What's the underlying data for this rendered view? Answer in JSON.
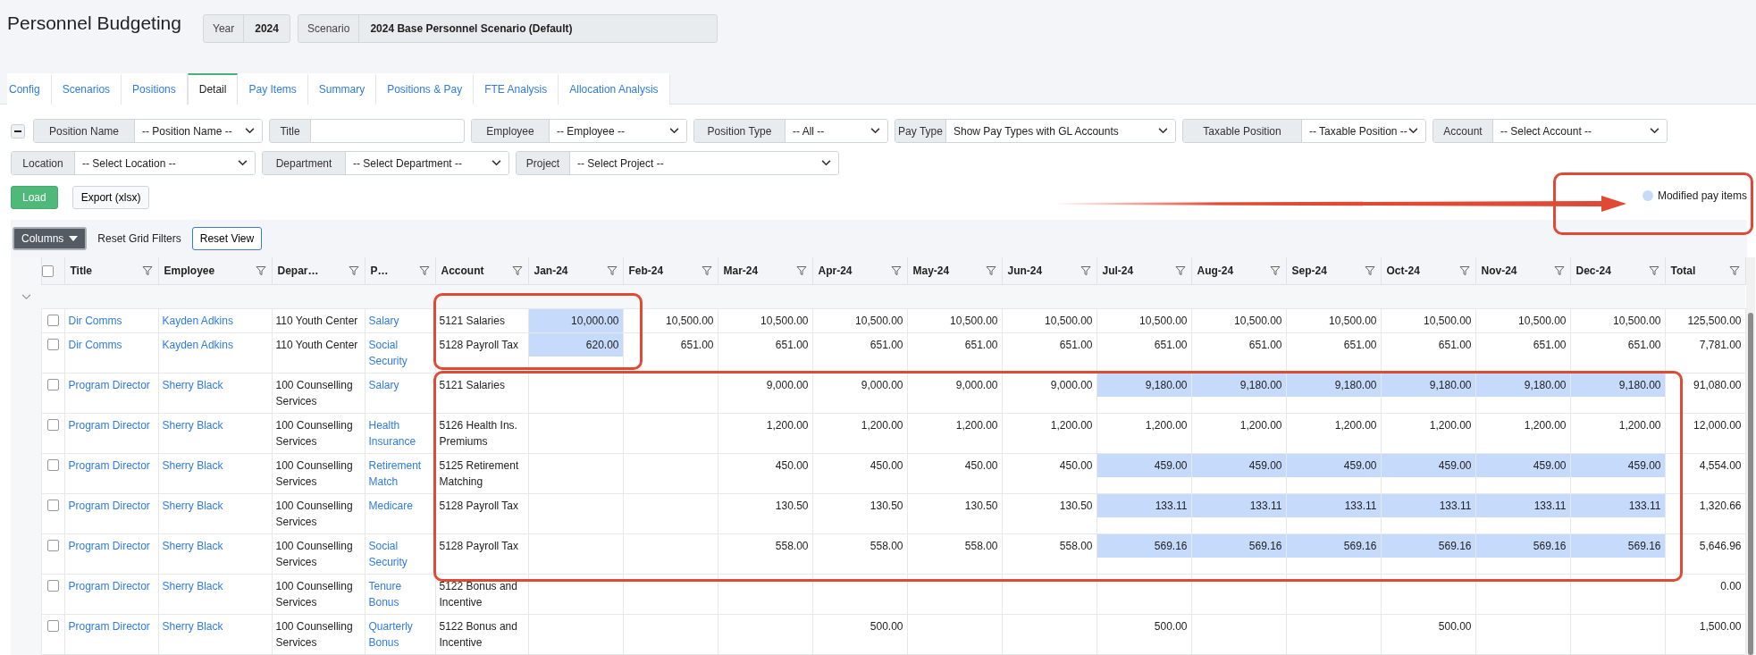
{
  "page_title": "Personnel Budgeting",
  "context": [
    {
      "label": "Year",
      "value": "2024"
    },
    {
      "label": "Scenario",
      "value": "2024 Base Personnel Scenario (Default)"
    }
  ],
  "tabs": [
    {
      "label": "Config",
      "selected": false
    },
    {
      "label": "Scenarios",
      "selected": false
    },
    {
      "label": "Positions",
      "selected": false
    },
    {
      "label": "Detail",
      "selected": true
    },
    {
      "label": "Pay Items",
      "selected": false
    },
    {
      "label": "Summary",
      "selected": false
    },
    {
      "label": "Positions & Pay",
      "selected": false
    },
    {
      "label": "FTE Analysis",
      "selected": false
    },
    {
      "label": "Allocation Analysis",
      "selected": false
    }
  ],
  "filters_expanded": true,
  "filters": [
    {
      "label": "Position Name",
      "kind": "select",
      "value": "-- Position Name --"
    },
    {
      "label": "Title",
      "kind": "text"
    },
    {
      "label": "Employee",
      "kind": "select",
      "value": "-- Employee --"
    },
    {
      "label": "Position Type",
      "kind": "select",
      "value": "-- All --"
    },
    {
      "label": "Pay Type",
      "kind": "select",
      "value": "Show Pay Types with GL Accounts"
    },
    {
      "label": "Taxable Position",
      "kind": "select",
      "value": "-- Taxable Position --"
    },
    {
      "label": "Account",
      "kind": "select",
      "value": "-- Select Account --"
    },
    {
      "label": "Location",
      "kind": "select",
      "value": "-- Select Location --"
    },
    {
      "label": "Department",
      "kind": "select",
      "value": "-- Select Department --"
    },
    {
      "label": "Project",
      "kind": "select",
      "value": "-- Select Project --"
    }
  ],
  "buttons": {
    "load": "Load",
    "export": "Export (xlsx)"
  },
  "legend": {
    "label": "Modified pay items",
    "color": "#c6dafc"
  },
  "grid_toolbar": {
    "columns": "Columns",
    "reset_filters": "Reset Grid Filters",
    "reset_view": "Reset View"
  },
  "grid": {
    "select_all_checked": false,
    "group_expanded": true,
    "columns": [
      "Title",
      "Employee",
      "Depar…",
      "P…",
      "Account",
      "Jan-24",
      "Feb-24",
      "Mar-24",
      "Apr-24",
      "May-24",
      "Jun-24",
      "Jul-24",
      "Aug-24",
      "Sep-24",
      "Oct-24",
      "Nov-24",
      "Dec-24",
      "Total"
    ],
    "rows": [
      {
        "checked": false,
        "title": "Dir Comms",
        "employee": "Kayden Adkins",
        "department": "110 Youth Center",
        "pay_item": "Salary",
        "account": "5121 Salaries",
        "total": "125,500.00",
        "months": [
          {
            "v": "10,000.00",
            "modified": true
          },
          {
            "v": "10,500.00",
            "modified": false
          },
          {
            "v": "10,500.00",
            "modified": false
          },
          {
            "v": "10,500.00",
            "modified": false
          },
          {
            "v": "10,500.00",
            "modified": false
          },
          {
            "v": "10,500.00",
            "modified": false
          },
          {
            "v": "10,500.00",
            "modified": false
          },
          {
            "v": "10,500.00",
            "modified": false
          },
          {
            "v": "10,500.00",
            "modified": false
          },
          {
            "v": "10,500.00",
            "modified": false
          },
          {
            "v": "10,500.00",
            "modified": false
          },
          {
            "v": "10,500.00",
            "modified": false
          }
        ]
      },
      {
        "checked": false,
        "title": "Dir Comms",
        "employee": "Kayden Adkins",
        "department": "110 Youth Center",
        "pay_item": "Social Security",
        "account": "5128 Payroll Tax",
        "total": "7,781.00",
        "months": [
          {
            "v": "620.00",
            "modified": true
          },
          {
            "v": "651.00",
            "modified": false
          },
          {
            "v": "651.00",
            "modified": false
          },
          {
            "v": "651.00",
            "modified": false
          },
          {
            "v": "651.00",
            "modified": false
          },
          {
            "v": "651.00",
            "modified": false
          },
          {
            "v": "651.00",
            "modified": false
          },
          {
            "v": "651.00",
            "modified": false
          },
          {
            "v": "651.00",
            "modified": false
          },
          {
            "v": "651.00",
            "modified": false
          },
          {
            "v": "651.00",
            "modified": false
          },
          {
            "v": "651.00",
            "modified": false
          }
        ]
      },
      {
        "checked": false,
        "title": "Program Director",
        "employee": "Sherry Black",
        "department": "100 Counselling Services",
        "pay_item": "Salary",
        "account": "5121 Salaries",
        "total": "91,080.00",
        "months": [
          {
            "modified": false
          },
          {
            "modified": false
          },
          {
            "v": "9,000.00",
            "modified": false
          },
          {
            "v": "9,000.00",
            "modified": false
          },
          {
            "v": "9,000.00",
            "modified": false
          },
          {
            "v": "9,000.00",
            "modified": false
          },
          {
            "v": "9,180.00",
            "modified": true
          },
          {
            "v": "9,180.00",
            "modified": true
          },
          {
            "v": "9,180.00",
            "modified": true
          },
          {
            "v": "9,180.00",
            "modified": true
          },
          {
            "v": "9,180.00",
            "modified": true
          },
          {
            "v": "9,180.00",
            "modified": true
          }
        ]
      },
      {
        "checked": false,
        "title": "Program Director",
        "employee": "Sherry Black",
        "department": "100 Counselling Services",
        "pay_item": "Health Insurance",
        "account": "5126 Health Ins. Premiums",
        "total": "12,000.00",
        "months": [
          {
            "modified": false
          },
          {
            "modified": false
          },
          {
            "v": "1,200.00",
            "modified": false
          },
          {
            "v": "1,200.00",
            "modified": false
          },
          {
            "v": "1,200.00",
            "modified": false
          },
          {
            "v": "1,200.00",
            "modified": false
          },
          {
            "v": "1,200.00",
            "modified": false
          },
          {
            "v": "1,200.00",
            "modified": false
          },
          {
            "v": "1,200.00",
            "modified": false
          },
          {
            "v": "1,200.00",
            "modified": false
          },
          {
            "v": "1,200.00",
            "modified": false
          },
          {
            "v": "1,200.00",
            "modified": false
          }
        ]
      },
      {
        "checked": false,
        "title": "Program Director",
        "employee": "Sherry Black",
        "department": "100 Counselling Services",
        "pay_item": "Retirement Match",
        "account": "5125 Retirement Matching",
        "total": "4,554.00",
        "months": [
          {
            "modified": false
          },
          {
            "modified": false
          },
          {
            "v": "450.00",
            "modified": false
          },
          {
            "v": "450.00",
            "modified": false
          },
          {
            "v": "450.00",
            "modified": false
          },
          {
            "v": "450.00",
            "modified": false
          },
          {
            "v": "459.00",
            "modified": true
          },
          {
            "v": "459.00",
            "modified": true
          },
          {
            "v": "459.00",
            "modified": true
          },
          {
            "v": "459.00",
            "modified": true
          },
          {
            "v": "459.00",
            "modified": true
          },
          {
            "v": "459.00",
            "modified": true
          }
        ]
      },
      {
        "checked": false,
        "title": "Program Director",
        "employee": "Sherry Black",
        "department": "100 Counselling Services",
        "pay_item": "Medicare",
        "account": "5128 Payroll Tax",
        "total": "1,320.66",
        "months": [
          {
            "modified": false
          },
          {
            "modified": false
          },
          {
            "v": "130.50",
            "modified": false
          },
          {
            "v": "130.50",
            "modified": false
          },
          {
            "v": "130.50",
            "modified": false
          },
          {
            "v": "130.50",
            "modified": false
          },
          {
            "v": "133.11",
            "modified": true
          },
          {
            "v": "133.11",
            "modified": true
          },
          {
            "v": "133.11",
            "modified": true
          },
          {
            "v": "133.11",
            "modified": true
          },
          {
            "v": "133.11",
            "modified": true
          },
          {
            "v": "133.11",
            "modified": true
          }
        ]
      },
      {
        "checked": false,
        "title": "Program Director",
        "employee": "Sherry Black",
        "department": "100 Counselling Services",
        "pay_item": "Social Security",
        "account": "5128 Payroll Tax",
        "total": "5,646.96",
        "months": [
          {
            "modified": false
          },
          {
            "modified": false
          },
          {
            "v": "558.00",
            "modified": false
          },
          {
            "v": "558.00",
            "modified": false
          },
          {
            "v": "558.00",
            "modified": false
          },
          {
            "v": "558.00",
            "modified": false
          },
          {
            "v": "569.16",
            "modified": true
          },
          {
            "v": "569.16",
            "modified": true
          },
          {
            "v": "569.16",
            "modified": true
          },
          {
            "v": "569.16",
            "modified": true
          },
          {
            "v": "569.16",
            "modified": true
          },
          {
            "v": "569.16",
            "modified": true
          }
        ]
      },
      {
        "checked": false,
        "title": "Program Director",
        "employee": "Sherry Black",
        "department": "100 Counselling Services",
        "pay_item": "Tenure Bonus",
        "account": "5122 Bonus and Incentive",
        "total": "0.00",
        "months": [
          {
            "modified": false
          },
          {
            "modified": false
          },
          {
            "modified": false
          },
          {
            "modified": false
          },
          {
            "modified": false
          },
          {
            "modified": false
          },
          {
            "modified": false
          },
          {
            "modified": false
          },
          {
            "modified": false
          },
          {
            "modified": false
          },
          {
            "modified": false
          },
          {
            "modified": false
          }
        ]
      },
      {
        "checked": false,
        "title": "Program Director",
        "employee": "Sherry Black",
        "department": "100 Counselling Services",
        "pay_item": "Quarterly Bonus",
        "account": "5122 Bonus and Incentive",
        "total": "1,500.00",
        "months": [
          {
            "modified": false
          },
          {
            "modified": false
          },
          {
            "modified": false
          },
          {
            "v": "500.00",
            "modified": false
          },
          {
            "modified": false
          },
          {
            "modified": false
          },
          {
            "v": "500.00",
            "modified": false
          },
          {
            "modified": false
          },
          {
            "modified": false
          },
          {
            "v": "500.00",
            "modified": false
          },
          {
            "modified": false
          },
          {
            "modified": false
          }
        ]
      }
    ]
  }
}
